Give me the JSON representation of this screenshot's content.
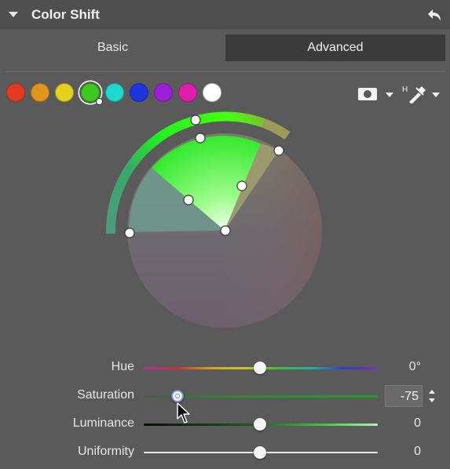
{
  "panel": {
    "title": "Color Shift"
  },
  "tabs": [
    {
      "label": "Basic",
      "active": false
    },
    {
      "label": "Advanced",
      "active": true
    }
  ],
  "swatches": [
    {
      "name": "red",
      "color": "#e23a22"
    },
    {
      "name": "orange",
      "color": "#e0951c"
    },
    {
      "name": "yellow",
      "color": "#e2d21e"
    },
    {
      "name": "green",
      "color": "#3cc81e",
      "selected": true
    },
    {
      "name": "cyan",
      "color": "#1ed7cd"
    },
    {
      "name": "blue",
      "color": "#1e34dd"
    },
    {
      "name": "purple",
      "color": "#9b1ed8"
    },
    {
      "name": "magenta",
      "color": "#dd1eab"
    },
    {
      "name": "white",
      "color": "#ffffff"
    }
  ],
  "tools": {
    "mask_icon": "mask-icon",
    "picker_icon": "hue-picker-icon"
  },
  "sliders": [
    {
      "label": "Hue",
      "value": "0°",
      "position": 0.5,
      "track": "hue"
    },
    {
      "label": "Saturation",
      "value": "-75",
      "position": 0.14,
      "track": "saturation",
      "active": true
    },
    {
      "label": "Luminance",
      "value": "0",
      "position": 0.5,
      "track": "luminance"
    },
    {
      "label": "Uniformity",
      "value": "0",
      "position": 0.5,
      "track": "neutral"
    }
  ]
}
